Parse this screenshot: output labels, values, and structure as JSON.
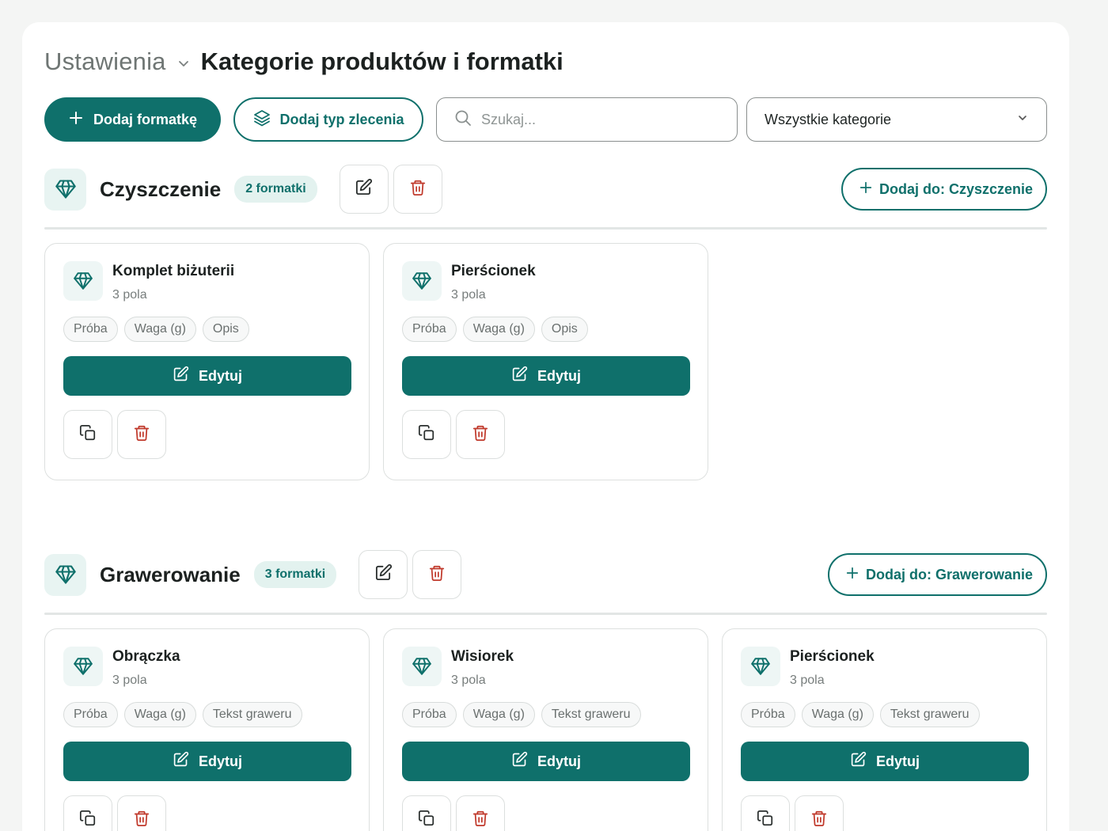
{
  "header": {
    "breadcrumb_parent": "Ustawienia",
    "title": "Kategorie produktów i formatki"
  },
  "toolbar": {
    "add_template_label": "Dodaj formatkę",
    "add_order_type_label": "Dodaj typ zlecenia",
    "search_placeholder": "Szukaj...",
    "category_filter_value": "Wszystkie kategorie"
  },
  "colors": {
    "accent": "#0f706b",
    "danger": "#c0392b",
    "badge_bg": "#e3f2ef"
  },
  "common": {
    "edit_label": "Edytuj"
  },
  "sections": [
    {
      "name": "Czyszczenie",
      "count_label": "2 formatki",
      "add_label": "Dodaj do: Czyszczenie",
      "cards": [
        {
          "title": "Komplet biżuterii",
          "subtitle": "3 pola",
          "fields": [
            "Próba",
            "Waga (g)",
            "Opis"
          ]
        },
        {
          "title": "Pierścionek",
          "subtitle": "3 pola",
          "fields": [
            "Próba",
            "Waga (g)",
            "Opis"
          ]
        }
      ]
    },
    {
      "name": "Grawerowanie",
      "count_label": "3 formatki",
      "add_label": "Dodaj do: Grawerowanie",
      "cards": [
        {
          "title": "Obrączka",
          "subtitle": "3 pola",
          "fields": [
            "Próba",
            "Waga (g)",
            "Tekst graweru"
          ]
        },
        {
          "title": "Wisiorek",
          "subtitle": "3 pola",
          "fields": [
            "Próba",
            "Waga (g)",
            "Tekst graweru"
          ]
        },
        {
          "title": "Pierścionek",
          "subtitle": "3 pola",
          "fields": [
            "Próba",
            "Waga (g)",
            "Tekst graweru"
          ]
        }
      ]
    }
  ]
}
